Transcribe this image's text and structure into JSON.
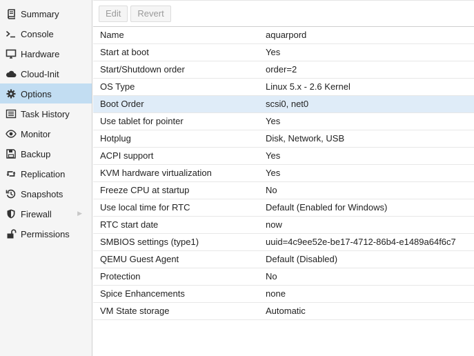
{
  "sidebar": {
    "items": [
      {
        "label": "Summary",
        "icon": "book-icon"
      },
      {
        "label": "Console",
        "icon": "terminal-icon"
      },
      {
        "label": "Hardware",
        "icon": "desktop-icon"
      },
      {
        "label": "Cloud-Init",
        "icon": "cloud-icon"
      },
      {
        "label": "Options",
        "icon": "gear-icon"
      },
      {
        "label": "Task History",
        "icon": "list-icon"
      },
      {
        "label": "Monitor",
        "icon": "eye-icon"
      },
      {
        "label": "Backup",
        "icon": "floppy-icon"
      },
      {
        "label": "Replication",
        "icon": "retweet-icon"
      },
      {
        "label": "Snapshots",
        "icon": "history-icon"
      },
      {
        "label": "Firewall",
        "icon": "shield-icon"
      },
      {
        "label": "Permissions",
        "icon": "unlock-icon"
      }
    ],
    "selected": "Options"
  },
  "toolbar": {
    "edit_label": "Edit",
    "revert_label": "Revert"
  },
  "options": {
    "rows": [
      {
        "name": "Name",
        "value": "aquarpord"
      },
      {
        "name": "Start at boot",
        "value": "Yes"
      },
      {
        "name": "Start/Shutdown order",
        "value": "order=2"
      },
      {
        "name": "OS Type",
        "value": "Linux 5.x - 2.6 Kernel"
      },
      {
        "name": "Boot Order",
        "value": "scsi0, net0"
      },
      {
        "name": "Use tablet for pointer",
        "value": "Yes"
      },
      {
        "name": "Hotplug",
        "value": "Disk, Network, USB"
      },
      {
        "name": "ACPI support",
        "value": "Yes"
      },
      {
        "name": "KVM hardware virtualization",
        "value": "Yes"
      },
      {
        "name": "Freeze CPU at startup",
        "value": "No"
      },
      {
        "name": "Use local time for RTC",
        "value": "Default (Enabled for Windows)"
      },
      {
        "name": "RTC start date",
        "value": "now"
      },
      {
        "name": "SMBIOS settings (type1)",
        "value": "uuid=4c9ee52e-be17-4712-86b4-e1489a64f6c7"
      },
      {
        "name": "QEMU Guest Agent",
        "value": "Default (Disabled)"
      },
      {
        "name": "Protection",
        "value": "No"
      },
      {
        "name": "Spice Enhancements",
        "value": "none"
      },
      {
        "name": "VM State storage",
        "value": "Automatic"
      }
    ],
    "selected_row": "Boot Order"
  },
  "colors": {
    "sidebar_bg": "#f5f5f5",
    "sidebar_selected": "#c2ddf2",
    "row_selected": "#dfecf8",
    "text": "#222222"
  }
}
